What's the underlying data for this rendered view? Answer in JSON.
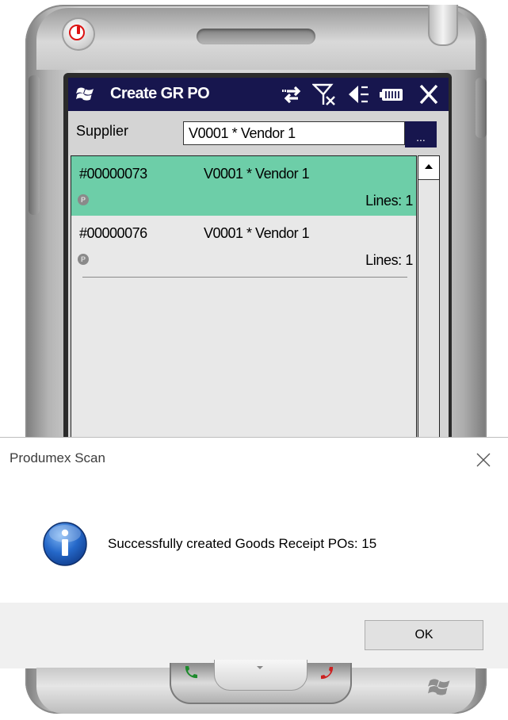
{
  "app": {
    "title": "Create GR PO",
    "status_icons": [
      "sync-icon",
      "no-signal-icon",
      "speaker-muted-icon",
      "battery-icon",
      "close-icon"
    ]
  },
  "supplier": {
    "label": "Supplier",
    "value": "V0001 * Vendor 1",
    "browse_label": "..."
  },
  "purchase_orders": [
    {
      "number": "#00000073",
      "vendor": "V0001 * Vendor 1",
      "badge": "P",
      "lines": "Lines: 1",
      "selected": true
    },
    {
      "number": "#00000076",
      "vendor": "V0001 * Vendor 1",
      "badge": "P",
      "lines": "Lines: 1",
      "selected": false
    }
  ],
  "dialog": {
    "title": "Produmex Scan",
    "message": "Successfully created Goods Receipt POs: 15",
    "ok_label": "OK"
  },
  "colors": {
    "title_bar": "#17164e",
    "selected_row": "#6dcea8",
    "power_button": "#dd1111"
  }
}
